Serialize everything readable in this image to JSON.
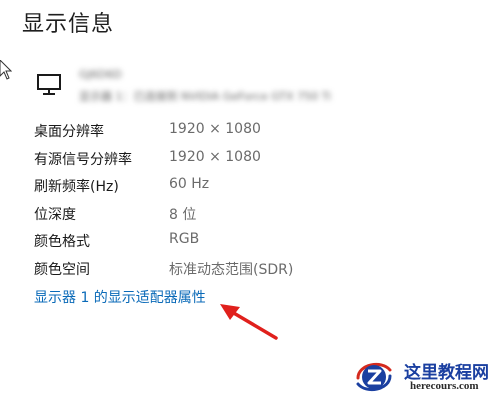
{
  "page": {
    "title": "显示信息"
  },
  "monitor": {
    "icon": "monitor-icon",
    "name": "GJ6D6D",
    "description": "显示器 1：已连接到 NVIDIA GeForce GTX 750 Ti"
  },
  "info": {
    "rows": [
      {
        "label": "桌面分辨率",
        "value": "1920 × 1080"
      },
      {
        "label": "有源信号分辨率",
        "value": "1920 × 1080"
      },
      {
        "label": "刷新频率(Hz)",
        "value": "60 Hz"
      },
      {
        "label": "位深度",
        "value": "8 位"
      },
      {
        "label": "颜色格式",
        "value": "RGB"
      },
      {
        "label": "颜色空间",
        "value": "标准动态范围(SDR)"
      }
    ]
  },
  "link": {
    "adapter_properties": "显示器 1 的显示适配器属性"
  },
  "watermark": {
    "title": "这里教程网",
    "url": "herecours.com"
  },
  "colors": {
    "link": "#0a6ab8",
    "arrow": "#e0201c",
    "watermark_blue": "#1a3fa0"
  }
}
